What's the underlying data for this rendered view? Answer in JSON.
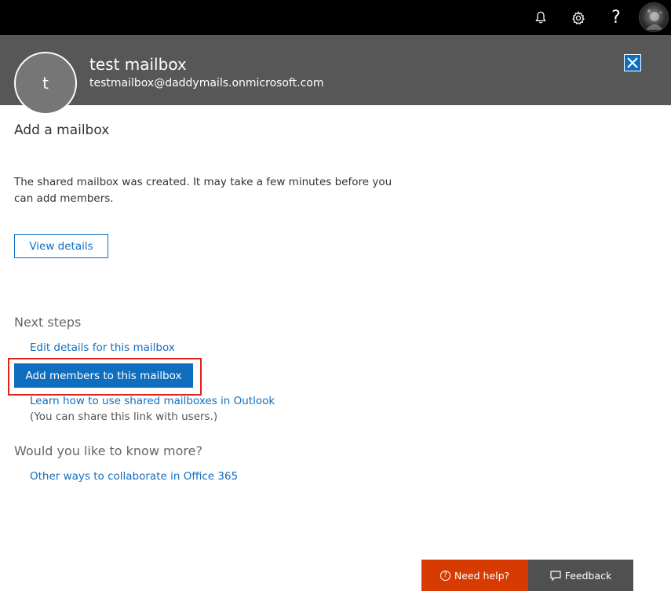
{
  "topbar": {
    "icons": [
      "bell-icon",
      "gear-icon",
      "help-icon",
      "user-avatar"
    ],
    "help_glyph": "?"
  },
  "header": {
    "avatar_initial": "t",
    "name": "test mailbox",
    "email": "testmailbox@daddymails.onmicrosoft.com",
    "close_icon": "close-icon"
  },
  "main": {
    "title": "Add a mailbox",
    "message": "The shared mailbox was created. It may take a few minutes before you can add members.",
    "view_details_label": "View details",
    "next_steps": {
      "title": "Next steps",
      "edit_link": "Edit details for this mailbox",
      "add_members_label": "Add members to this mailbox",
      "learn_link": "Learn how to use shared mailboxes in Outlook",
      "share_note": "(You can share this link with users.)"
    },
    "know_more": {
      "title": "Would you like to know more?",
      "other_link": "Other ways to collaborate in Office 365"
    }
  },
  "footer": {
    "need_help_label": "Need help?",
    "feedback_label": "Feedback"
  },
  "colors": {
    "topbar": "#000000",
    "header": "#575757",
    "accent": "#106ebe",
    "need_help": "#d83b01",
    "feedback": "#505050",
    "highlight": "#e2231a"
  }
}
